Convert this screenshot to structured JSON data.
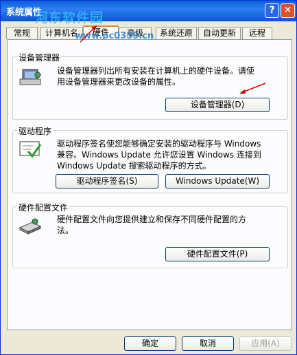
{
  "window": {
    "title": "系统属性"
  },
  "watermark": {
    "text": "河东软件园",
    "url": "www.pc0359.cn"
  },
  "titlebar": {
    "help": "?",
    "close": "✕"
  },
  "tabs": [
    {
      "label": "常规"
    },
    {
      "label": "计算机名"
    },
    {
      "label": "硬件"
    },
    {
      "label": "高级"
    },
    {
      "label": "系统还原"
    },
    {
      "label": "自动更新"
    },
    {
      "label": "远程"
    }
  ],
  "device_manager": {
    "heading": "设备管理器",
    "description_line1": "设备管理器列出所有安装在计算机上的硬件设备。请使",
    "description_line2": "用设备管理器来更改设备的属性。",
    "button": "设备管理器(D)",
    "icon": "device-manager-icon"
  },
  "drivers": {
    "heading": "驱动程序",
    "description_line1": "驱动程序签名使您能够确定安装的驱动程序与 Windows",
    "description_line2": "兼容。Windows Update 允许您设置 Windows 连接到",
    "description_line3": "Windows Update 搜索驱动程序的方式。",
    "signing_button": "驱动程序签名(S)",
    "update_button": "Windows Update(W)",
    "icon": "driver-signing-icon"
  },
  "hardware_profiles": {
    "heading": "硬件配置文件",
    "description_line1": "硬件配置文件向您提供建立和保存不同硬件配置的方",
    "description_line2": "法。",
    "button": "硬件配置文件(P)",
    "icon": "hardware-profile-icon"
  },
  "footer": {
    "ok": "确定",
    "cancel": "取消",
    "apply": "应用(A)"
  },
  "colors": {
    "annotation_arrow": "#c00000",
    "tab_accent": "#e68b2c"
  }
}
